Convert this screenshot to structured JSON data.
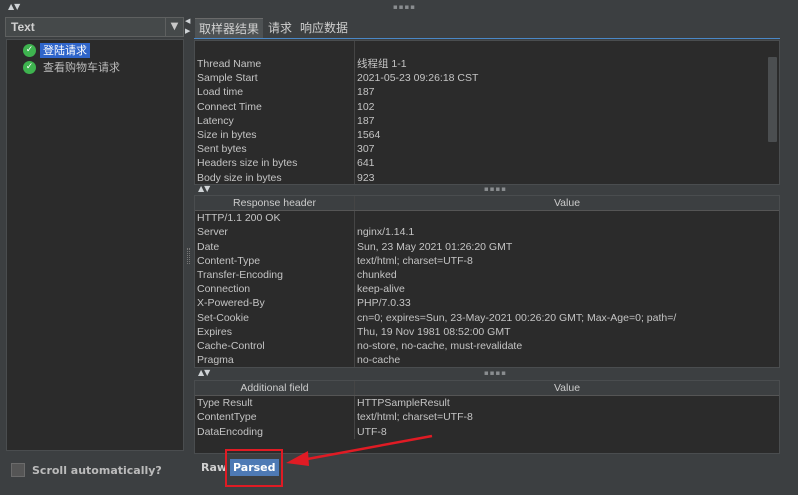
{
  "window": {
    "top_splitter_arrows": "▲▼"
  },
  "left_panel": {
    "renderer_select": {
      "value": "Text",
      "arrow": "▼"
    },
    "tree": [
      {
        "label": "登陆请求",
        "selected": true
      },
      {
        "label": "查看购物车请求",
        "selected": false
      }
    ],
    "scroll_auto_label": "Scroll automatically?"
  },
  "tabs": [
    {
      "label": "取样器结果",
      "active": true
    },
    {
      "label": "请求",
      "active": false
    },
    {
      "label": "响应数据",
      "active": false
    }
  ],
  "sampler_result": {
    "rows": [
      {
        "key": "Thread Name",
        "value": "线程组 1-1"
      },
      {
        "key": "Sample Start",
        "value": "2021-05-23 09:26:18 CST"
      },
      {
        "key": "Load time",
        "value": "187"
      },
      {
        "key": "Connect Time",
        "value": "102"
      },
      {
        "key": "Latency",
        "value": "187"
      },
      {
        "key": "Size in bytes",
        "value": "1564"
      },
      {
        "key": "Sent bytes",
        "value": "307"
      },
      {
        "key": "Headers size in bytes",
        "value": "641"
      },
      {
        "key": "Body size in bytes",
        "value": "923"
      }
    ]
  },
  "response_header": {
    "columns": [
      "Response header",
      "Value"
    ],
    "rows": [
      {
        "key": "HTTP/1.1 200 OK",
        "value": ""
      },
      {
        "key": "Server",
        "value": "nginx/1.14.1"
      },
      {
        "key": "Date",
        "value": "Sun, 23 May 2021 01:26:20 GMT"
      },
      {
        "key": "Content-Type",
        "value": "text/html; charset=UTF-8"
      },
      {
        "key": "Transfer-Encoding",
        "value": "chunked"
      },
      {
        "key": "Connection",
        "value": "keep-alive"
      },
      {
        "key": "X-Powered-By",
        "value": "PHP/7.0.33"
      },
      {
        "key": "Set-Cookie",
        "value": "cn=0; expires=Sun, 23-May-2021 00:26:20 GMT; Max-Age=0; path=/"
      },
      {
        "key": "Expires",
        "value": "Thu, 19 Nov 1981 08:52:00 GMT"
      },
      {
        "key": "Cache-Control",
        "value": "no-store, no-cache, must-revalidate"
      },
      {
        "key": "Pragma",
        "value": "no-cache"
      }
    ]
  },
  "additional_field": {
    "columns": [
      "Additional field",
      "Value"
    ],
    "rows": [
      {
        "key": "Type Result",
        "value": "HTTPSampleResult"
      },
      {
        "key": "ContentType",
        "value": "text/html; charset=UTF-8"
      },
      {
        "key": "DataEncoding",
        "value": "UTF-8"
      }
    ]
  },
  "bottom_tabs": [
    {
      "label": "Raw",
      "active": false
    },
    {
      "label": "Parsed",
      "active": true
    }
  ],
  "colors": {
    "highlight": "#e01b24",
    "selection": "#2f65ca",
    "tab_accent": "#4a88c7"
  }
}
